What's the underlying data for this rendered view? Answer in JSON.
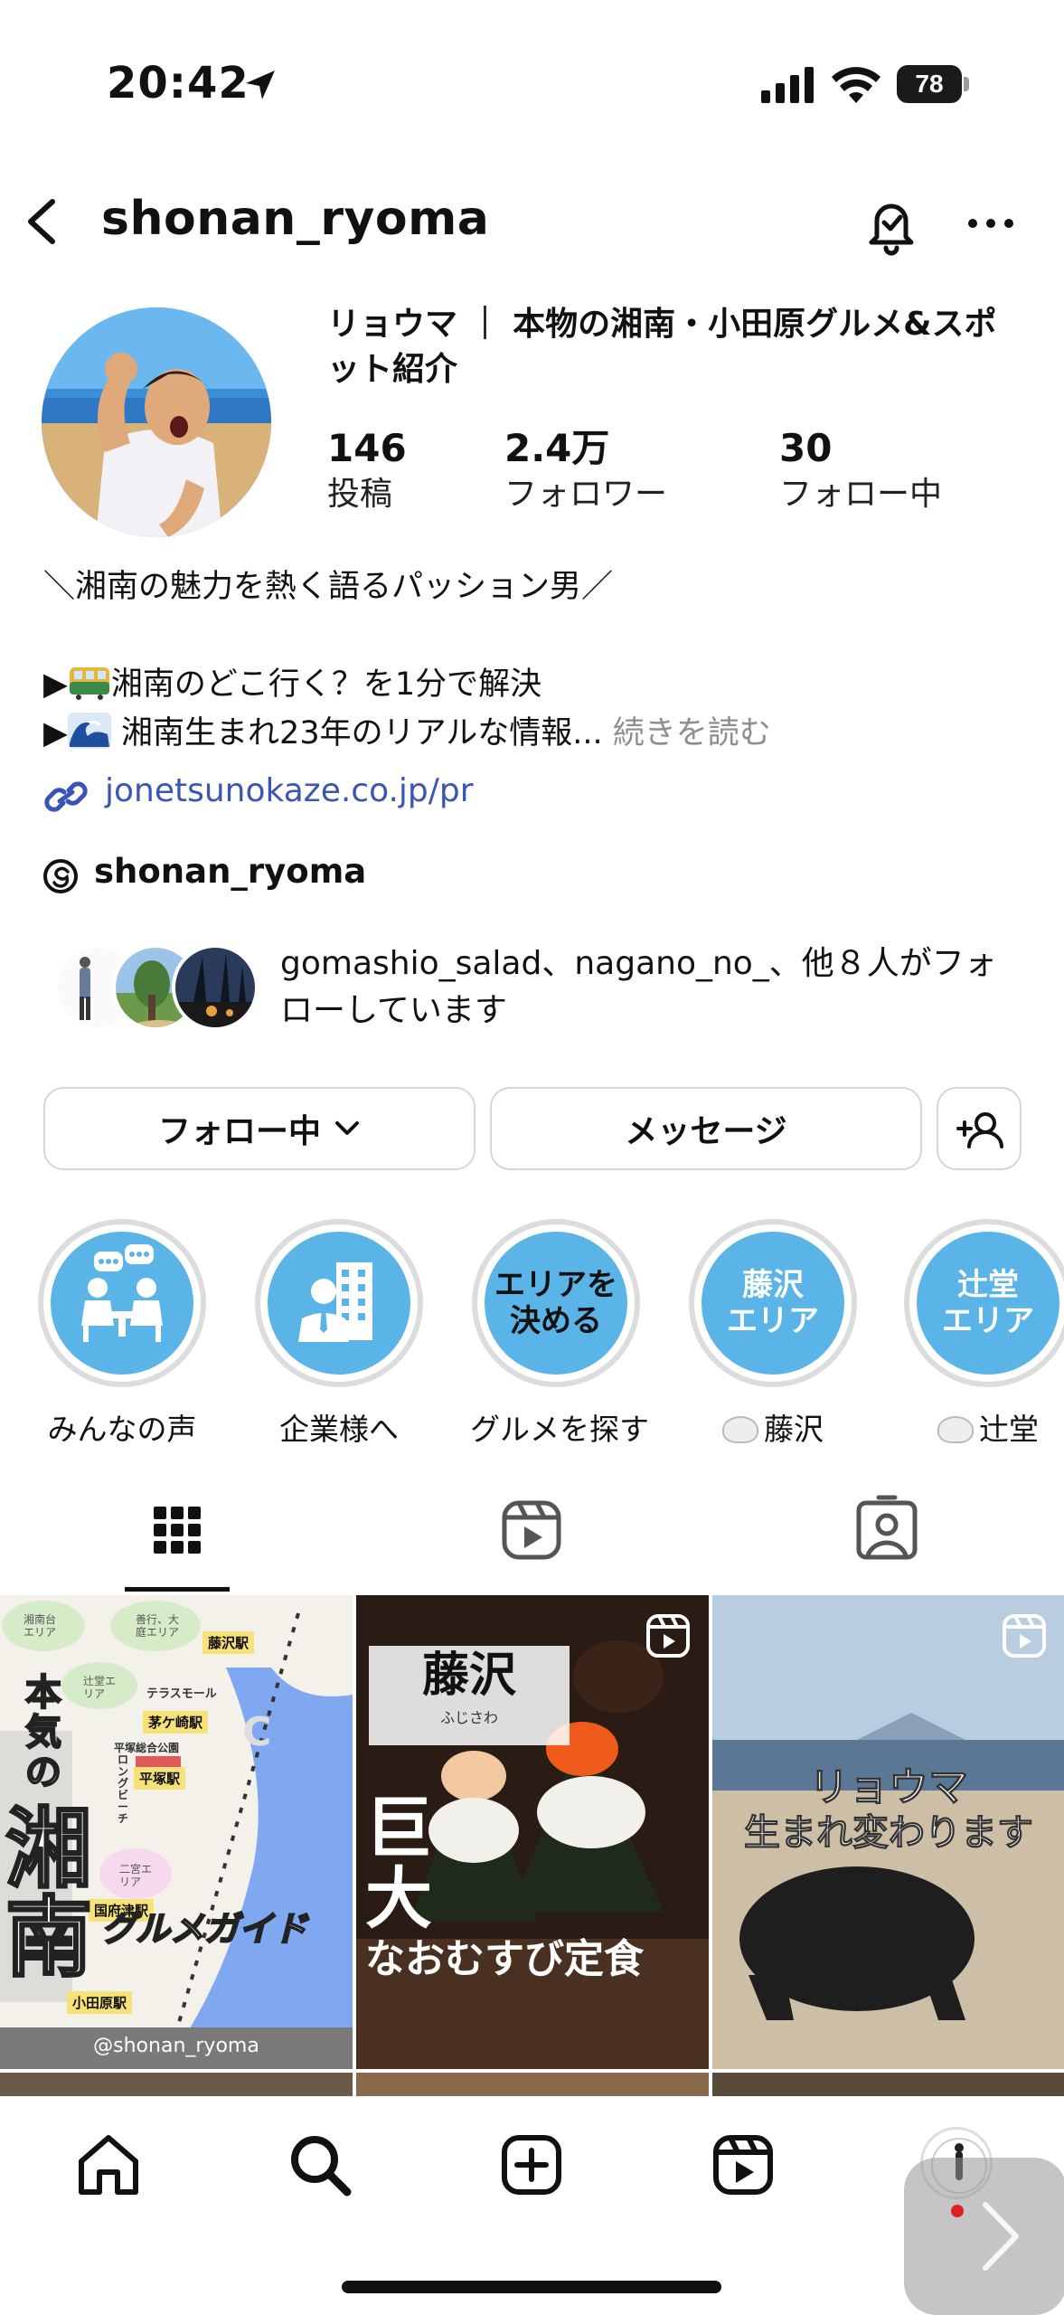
{
  "status_bar": {
    "time": "20:42",
    "battery": "78"
  },
  "header": {
    "username": "shonan_ryoma"
  },
  "profile": {
    "name": "リョウマ ｜ 本物の湘南・小田原グルメ&スポット紹介",
    "stats": [
      {
        "value": "146",
        "label": "投稿"
      },
      {
        "value": "2.4万",
        "label": "フォロワー"
      },
      {
        "value": "30",
        "label": "フォロー中"
      }
    ],
    "bio": {
      "line1": "＼湘南の魅力を熱く語るパッション男／",
      "line2_prefix": "▶",
      "line2_text": "湘南のどこ行く？を1分で解決",
      "line3_prefix": "▶",
      "line3_text": " 湘南生まれ23年のリアルな情報...",
      "more": " 続きを読む"
    },
    "website": "jonetsunokaze.co.jp/pr",
    "threads": "shonan_ryoma",
    "followed_by": "gomashio_salad、nagano_no_、他８人がフォローしています"
  },
  "actions": {
    "following": "フォロー中",
    "message": "メッセージ"
  },
  "highlights": [
    {
      "label": "みんなの声",
      "icon": "people-chat-icon"
    },
    {
      "label": "企業様へ",
      "icon": "businessman-icon"
    },
    {
      "label": "グルメを探す",
      "inner_text": "エリアを\n決める"
    },
    {
      "label": "藤沢",
      "inner_text": "藤沢\nエリア",
      "emoji": "rice-bowl"
    },
    {
      "label": "辻堂",
      "inner_text": "辻堂\nエリア",
      "emoji": "rice-bowl"
    }
  ],
  "tabs": [
    "grid-icon",
    "reels-icon",
    "tagged-icon"
  ],
  "posts": [
    {
      "title_vertical": "本気の",
      "title_main": "湘南",
      "subtitle": "グルメガイド",
      "stations": [
        "藤沢駅",
        "茅ケ崎駅",
        "平塚駅",
        "国府津駅",
        "小田原駅"
      ],
      "areas": [
        "湘南台エリア",
        "善行、大庭エリア",
        "辻堂エリア",
        "二宮エリア"
      ],
      "labels": [
        "テラスモール",
        "平塚総合公園",
        "ロングビーチ"
      ],
      "letter": "C",
      "handle": "@shonan_ryoma"
    },
    {
      "tag_main": "藤沢",
      "tag_sub": "ふじさわ",
      "title_a": "巨",
      "title_b": "大",
      "title_c": "なおむすび定食",
      "reel": true
    },
    {
      "title1": "リョウマ",
      "title2": "生まれ変わります",
      "reel": true
    }
  ],
  "nav": [
    "home-icon",
    "search-icon",
    "create-icon",
    "reels-icon",
    "profile-avatar"
  ],
  "colors": {
    "link": "#3a55b4",
    "highlight_bg": "#5ab4e8",
    "muted": "#8e8e8e"
  }
}
